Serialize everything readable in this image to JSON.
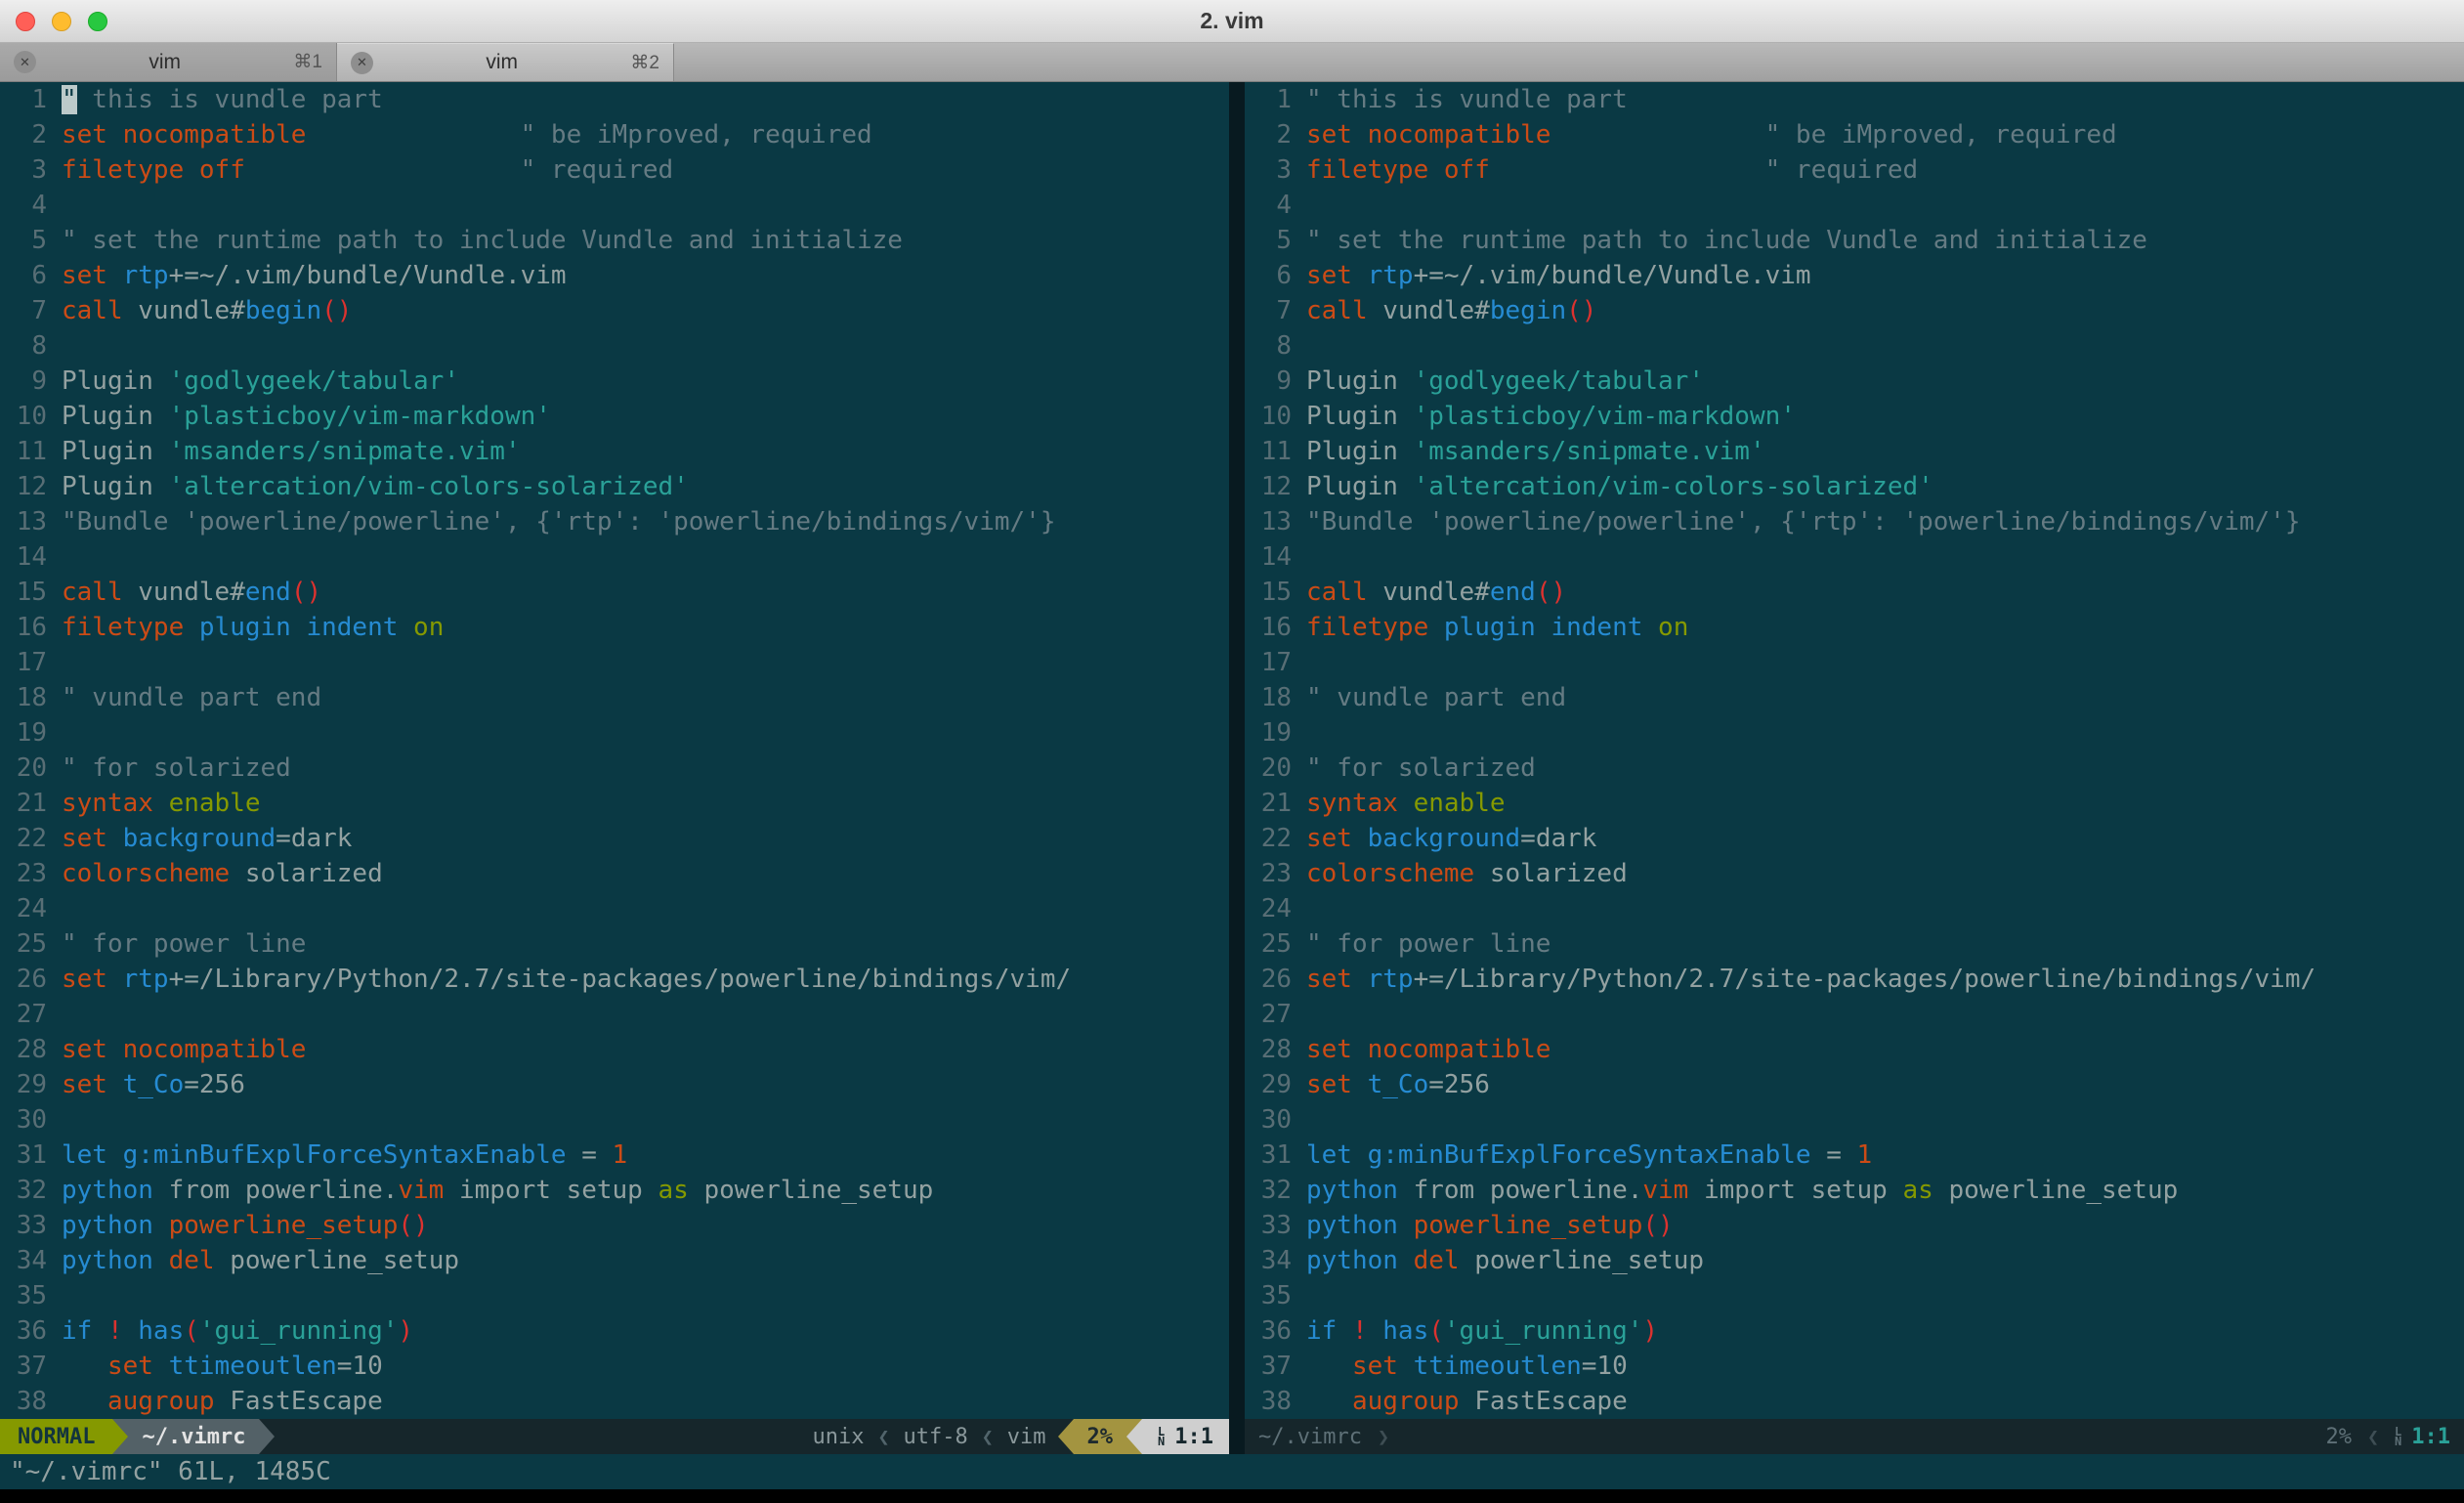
{
  "window": {
    "title": "2. vim"
  },
  "tabs": [
    {
      "label": "vim",
      "shortcut": "⌘1",
      "active": false
    },
    {
      "label": "vim",
      "shortcut": "⌘2",
      "active": true
    }
  ],
  "icons": {
    "tab_close": "✕",
    "sep_left": "❮",
    "sep_right": "❯",
    "line_glyph_top": "L",
    "line_glyph_bottom": "N"
  },
  "colors": {
    "syntax": {
      "n": "#93a1a1",
      "c": "#657b83",
      "o": "#cb4b16",
      "r": "#dc322f",
      "b": "#268bd2",
      "s": "#2aa198",
      "g": "#859900"
    },
    "theme": {
      "editor_bg": "#0a3944",
      "divider_bg": "#081a20",
      "status_dark": "#16262b",
      "status_fg": "#8a989b",
      "sep_fg": "#51646b",
      "mode_bg": "#859900",
      "mode_fg": "#13343d",
      "file_bg": "#536167",
      "file_fg": "#e4e4e4",
      "percent_bg": "#a39440",
      "percent_fg": "#1e2a2e",
      "pos_bg": "#cfcfcf",
      "pos_fg": "#15262c",
      "inactive_fg": "#5e7077",
      "inactive_pos_fg": "#2aa198",
      "cmd_fg": "#93a1a1",
      "cursor_bg": "#bccaca",
      "lnum_fg": "#586e75"
    }
  },
  "cursor": {
    "pane": "left",
    "line": 1,
    "col": 1
  },
  "lines": [
    {
      "n": 1,
      "t": [
        [
          "c",
          "\" this is vundle part"
        ]
      ]
    },
    {
      "n": 2,
      "t": [
        [
          "o",
          "set"
        ],
        [
          "n",
          " "
        ],
        [
          "o",
          "nocompatible"
        ],
        [
          "n",
          "              "
        ],
        [
          "c",
          "\" be iMproved, required"
        ]
      ]
    },
    {
      "n": 3,
      "t": [
        [
          "o",
          "filetype"
        ],
        [
          "n",
          " "
        ],
        [
          "o",
          "off"
        ],
        [
          "n",
          "                  "
        ],
        [
          "c",
          "\" required"
        ]
      ]
    },
    {
      "n": 4,
      "t": []
    },
    {
      "n": 5,
      "t": [
        [
          "c",
          "\" set the runtime path to include Vundle and initialize"
        ]
      ]
    },
    {
      "n": 6,
      "t": [
        [
          "o",
          "set"
        ],
        [
          "n",
          " "
        ],
        [
          "b",
          "rtp"
        ],
        [
          "n",
          "+=~/.vim/bundle/Vundle.vim"
        ]
      ]
    },
    {
      "n": 7,
      "t": [
        [
          "o",
          "call"
        ],
        [
          "n",
          " vundle#"
        ],
        [
          "b",
          "begin"
        ],
        [
          "r",
          "()"
        ]
      ]
    },
    {
      "n": 8,
      "t": []
    },
    {
      "n": 9,
      "t": [
        [
          "n",
          "Plugin "
        ],
        [
          "s",
          "'godlygeek/tabular'"
        ]
      ]
    },
    {
      "n": 10,
      "t": [
        [
          "n",
          "Plugin "
        ],
        [
          "s",
          "'plasticboy/vim-markdown'"
        ]
      ]
    },
    {
      "n": 11,
      "t": [
        [
          "n",
          "Plugin "
        ],
        [
          "s",
          "'msanders/snipmate.vim'"
        ]
      ]
    },
    {
      "n": 12,
      "t": [
        [
          "n",
          "Plugin "
        ],
        [
          "s",
          "'altercation/vim-colors-solarized'"
        ]
      ]
    },
    {
      "n": 13,
      "t": [
        [
          "c",
          "\"Bundle 'powerline/powerline', {'rtp': 'powerline/bindings/vim/'}"
        ]
      ]
    },
    {
      "n": 14,
      "t": []
    },
    {
      "n": 15,
      "t": [
        [
          "o",
          "call"
        ],
        [
          "n",
          " vundle#"
        ],
        [
          "b",
          "end"
        ],
        [
          "r",
          "()"
        ]
      ]
    },
    {
      "n": 16,
      "t": [
        [
          "o",
          "filetype"
        ],
        [
          "n",
          " "
        ],
        [
          "b",
          "plugin"
        ],
        [
          "n",
          " "
        ],
        [
          "b",
          "indent"
        ],
        [
          "n",
          " "
        ],
        [
          "g",
          "on"
        ]
      ]
    },
    {
      "n": 17,
      "t": []
    },
    {
      "n": 18,
      "t": [
        [
          "c",
          "\" vundle part end"
        ]
      ]
    },
    {
      "n": 19,
      "t": []
    },
    {
      "n": 20,
      "t": [
        [
          "c",
          "\" for solarized"
        ]
      ]
    },
    {
      "n": 21,
      "t": [
        [
          "o",
          "syntax"
        ],
        [
          "n",
          " "
        ],
        [
          "g",
          "enable"
        ]
      ]
    },
    {
      "n": 22,
      "t": [
        [
          "o",
          "set"
        ],
        [
          "n",
          " "
        ],
        [
          "b",
          "background"
        ],
        [
          "n",
          "=dark"
        ]
      ]
    },
    {
      "n": 23,
      "t": [
        [
          "o",
          "colorscheme"
        ],
        [
          "n",
          " solarized"
        ]
      ]
    },
    {
      "n": 24,
      "t": []
    },
    {
      "n": 25,
      "t": [
        [
          "c",
          "\" for power line"
        ]
      ]
    },
    {
      "n": 26,
      "t": [
        [
          "o",
          "set"
        ],
        [
          "n",
          " "
        ],
        [
          "b",
          "rtp"
        ],
        [
          "n",
          "+=/Library/Python/2.7/site-packages/powerline/bindings/vim/"
        ]
      ]
    },
    {
      "n": 27,
      "t": []
    },
    {
      "n": 28,
      "t": [
        [
          "o",
          "set"
        ],
        [
          "n",
          " "
        ],
        [
          "o",
          "nocompatible"
        ]
      ]
    },
    {
      "n": 29,
      "t": [
        [
          "o",
          "set"
        ],
        [
          "n",
          " "
        ],
        [
          "b",
          "t_Co"
        ],
        [
          "n",
          "=256"
        ]
      ]
    },
    {
      "n": 30,
      "t": []
    },
    {
      "n": 31,
      "t": [
        [
          "b",
          "let"
        ],
        [
          "n",
          " "
        ],
        [
          "b",
          "g:minBufExplForceSyntaxEnable"
        ],
        [
          "n",
          " = "
        ],
        [
          "o",
          "1"
        ]
      ]
    },
    {
      "n": 32,
      "t": [
        [
          "b",
          "python"
        ],
        [
          "n",
          " from powerline."
        ],
        [
          "o",
          "vim"
        ],
        [
          "n",
          " import setup "
        ],
        [
          "g",
          "as"
        ],
        [
          "n",
          " powerline_setup"
        ]
      ]
    },
    {
      "n": 33,
      "t": [
        [
          "b",
          "python"
        ],
        [
          "n",
          " "
        ],
        [
          "o",
          "powerline_setup"
        ],
        [
          "r",
          "()"
        ]
      ]
    },
    {
      "n": 34,
      "t": [
        [
          "b",
          "python"
        ],
        [
          "n",
          " "
        ],
        [
          "o",
          "del"
        ],
        [
          "n",
          " powerline_setup"
        ]
      ]
    },
    {
      "n": 35,
      "t": []
    },
    {
      "n": 36,
      "t": [
        [
          "b",
          "if"
        ],
        [
          "n",
          " "
        ],
        [
          "r",
          "!"
        ],
        [
          "n",
          " "
        ],
        [
          "b",
          "has"
        ],
        [
          "r",
          "("
        ],
        [
          "s",
          "'gui_running'"
        ],
        [
          "r",
          ")"
        ]
      ]
    },
    {
      "n": 37,
      "t": [
        [
          "n",
          "   "
        ],
        [
          "o",
          "set"
        ],
        [
          "n",
          " "
        ],
        [
          "b",
          "ttimeoutlen"
        ],
        [
          "n",
          "=10"
        ]
      ]
    },
    {
      "n": 38,
      "t": [
        [
          "n",
          "   "
        ],
        [
          "o",
          "augroup"
        ],
        [
          "n",
          " FastEscape"
        ]
      ]
    }
  ],
  "statusline_left": {
    "mode": "NORMAL",
    "file": "~/.vimrc",
    "format": "unix",
    "encoding": "utf-8",
    "filetype": "vim",
    "percent": "2%",
    "position": "1:1"
  },
  "statusline_right": {
    "file": "~/.vimrc",
    "percent": "2%",
    "position": "1:1"
  },
  "command_line": "\"~/.vimrc\" 61L, 1485C"
}
